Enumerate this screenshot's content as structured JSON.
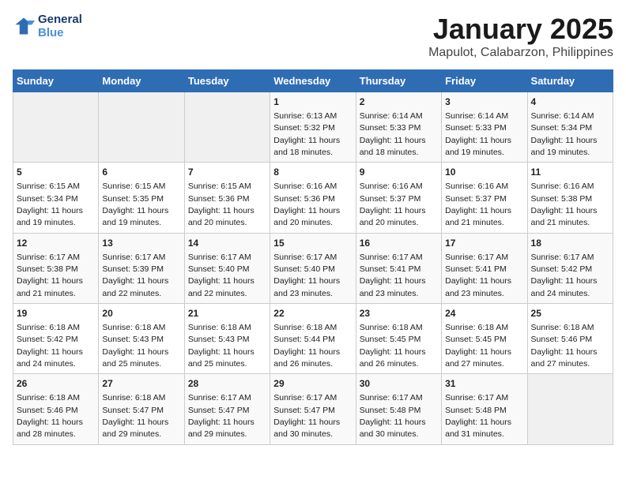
{
  "header": {
    "logo_line1": "General",
    "logo_line2": "Blue",
    "title": "January 2025",
    "subtitle": "Mapulot, Calabarzon, Philippines"
  },
  "days_of_week": [
    "Sunday",
    "Monday",
    "Tuesday",
    "Wednesday",
    "Thursday",
    "Friday",
    "Saturday"
  ],
  "weeks": [
    [
      {
        "day": "",
        "sunrise": "",
        "sunset": "",
        "daylight": ""
      },
      {
        "day": "",
        "sunrise": "",
        "sunset": "",
        "daylight": ""
      },
      {
        "day": "",
        "sunrise": "",
        "sunset": "",
        "daylight": ""
      },
      {
        "day": "1",
        "sunrise": "6:13 AM",
        "sunset": "5:32 PM",
        "daylight": "11 hours and 18 minutes."
      },
      {
        "day": "2",
        "sunrise": "6:14 AM",
        "sunset": "5:33 PM",
        "daylight": "11 hours and 18 minutes."
      },
      {
        "day": "3",
        "sunrise": "6:14 AM",
        "sunset": "5:33 PM",
        "daylight": "11 hours and 19 minutes."
      },
      {
        "day": "4",
        "sunrise": "6:14 AM",
        "sunset": "5:34 PM",
        "daylight": "11 hours and 19 minutes."
      }
    ],
    [
      {
        "day": "5",
        "sunrise": "6:15 AM",
        "sunset": "5:34 PM",
        "daylight": "11 hours and 19 minutes."
      },
      {
        "day": "6",
        "sunrise": "6:15 AM",
        "sunset": "5:35 PM",
        "daylight": "11 hours and 19 minutes."
      },
      {
        "day": "7",
        "sunrise": "6:15 AM",
        "sunset": "5:36 PM",
        "daylight": "11 hours and 20 minutes."
      },
      {
        "day": "8",
        "sunrise": "6:16 AM",
        "sunset": "5:36 PM",
        "daylight": "11 hours and 20 minutes."
      },
      {
        "day": "9",
        "sunrise": "6:16 AM",
        "sunset": "5:37 PM",
        "daylight": "11 hours and 20 minutes."
      },
      {
        "day": "10",
        "sunrise": "6:16 AM",
        "sunset": "5:37 PM",
        "daylight": "11 hours and 21 minutes."
      },
      {
        "day": "11",
        "sunrise": "6:16 AM",
        "sunset": "5:38 PM",
        "daylight": "11 hours and 21 minutes."
      }
    ],
    [
      {
        "day": "12",
        "sunrise": "6:17 AM",
        "sunset": "5:38 PM",
        "daylight": "11 hours and 21 minutes."
      },
      {
        "day": "13",
        "sunrise": "6:17 AM",
        "sunset": "5:39 PM",
        "daylight": "11 hours and 22 minutes."
      },
      {
        "day": "14",
        "sunrise": "6:17 AM",
        "sunset": "5:40 PM",
        "daylight": "11 hours and 22 minutes."
      },
      {
        "day": "15",
        "sunrise": "6:17 AM",
        "sunset": "5:40 PM",
        "daylight": "11 hours and 23 minutes."
      },
      {
        "day": "16",
        "sunrise": "6:17 AM",
        "sunset": "5:41 PM",
        "daylight": "11 hours and 23 minutes."
      },
      {
        "day": "17",
        "sunrise": "6:17 AM",
        "sunset": "5:41 PM",
        "daylight": "11 hours and 23 minutes."
      },
      {
        "day": "18",
        "sunrise": "6:17 AM",
        "sunset": "5:42 PM",
        "daylight": "11 hours and 24 minutes."
      }
    ],
    [
      {
        "day": "19",
        "sunrise": "6:18 AM",
        "sunset": "5:42 PM",
        "daylight": "11 hours and 24 minutes."
      },
      {
        "day": "20",
        "sunrise": "6:18 AM",
        "sunset": "5:43 PM",
        "daylight": "11 hours and 25 minutes."
      },
      {
        "day": "21",
        "sunrise": "6:18 AM",
        "sunset": "5:43 PM",
        "daylight": "11 hours and 25 minutes."
      },
      {
        "day": "22",
        "sunrise": "6:18 AM",
        "sunset": "5:44 PM",
        "daylight": "11 hours and 26 minutes."
      },
      {
        "day": "23",
        "sunrise": "6:18 AM",
        "sunset": "5:45 PM",
        "daylight": "11 hours and 26 minutes."
      },
      {
        "day": "24",
        "sunrise": "6:18 AM",
        "sunset": "5:45 PM",
        "daylight": "11 hours and 27 minutes."
      },
      {
        "day": "25",
        "sunrise": "6:18 AM",
        "sunset": "5:46 PM",
        "daylight": "11 hours and 27 minutes."
      }
    ],
    [
      {
        "day": "26",
        "sunrise": "6:18 AM",
        "sunset": "5:46 PM",
        "daylight": "11 hours and 28 minutes."
      },
      {
        "day": "27",
        "sunrise": "6:18 AM",
        "sunset": "5:47 PM",
        "daylight": "11 hours and 29 minutes."
      },
      {
        "day": "28",
        "sunrise": "6:17 AM",
        "sunset": "5:47 PM",
        "daylight": "11 hours and 29 minutes."
      },
      {
        "day": "29",
        "sunrise": "6:17 AM",
        "sunset": "5:47 PM",
        "daylight": "11 hours and 30 minutes."
      },
      {
        "day": "30",
        "sunrise": "6:17 AM",
        "sunset": "5:48 PM",
        "daylight": "11 hours and 30 minutes."
      },
      {
        "day": "31",
        "sunrise": "6:17 AM",
        "sunset": "5:48 PM",
        "daylight": "11 hours and 31 minutes."
      },
      {
        "day": "",
        "sunrise": "",
        "sunset": "",
        "daylight": ""
      }
    ]
  ]
}
